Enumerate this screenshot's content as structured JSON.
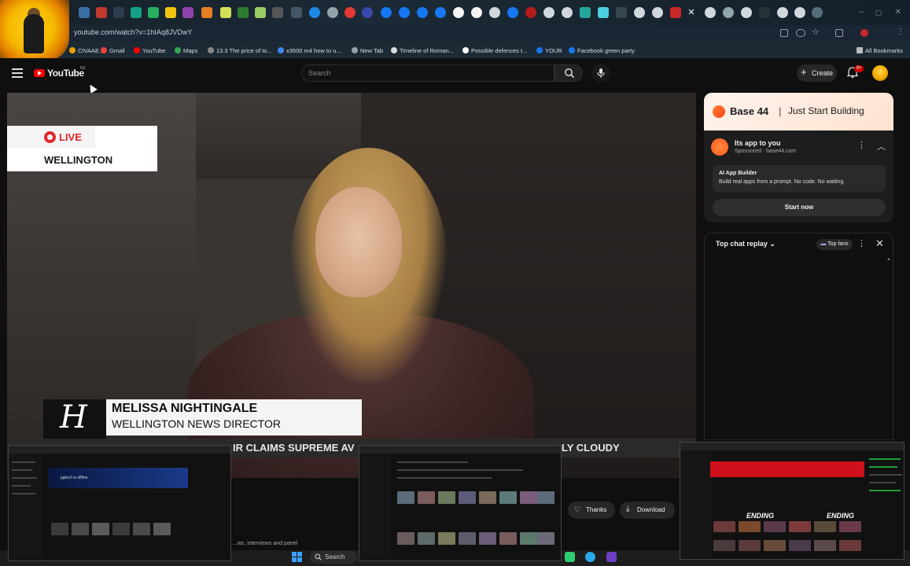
{
  "browser": {
    "url": "youtube.com/watch?v=1hIAq8JVDwY",
    "bookmarks": [
      {
        "label": "CIVAAE...",
        "color": "#e8a000"
      },
      {
        "label": "Gmail",
        "color": "#ea4335"
      },
      {
        "label": "YouTube",
        "color": "#ff0000"
      },
      {
        "label": "Maps",
        "color": "#34a853"
      },
      {
        "label": "13.3 The price of to...",
        "color": "#888888"
      },
      {
        "label": "x3500 m4 how to u...",
        "color": "#4285f4"
      },
      {
        "label": "New Tab",
        "color": "#9aa0a6"
      },
      {
        "label": "Timeline of Roman...",
        "color": "#dddddd"
      },
      {
        "label": "Possible defences t...",
        "color": "#ffffff"
      },
      {
        "label": "YOUR",
        "color": "#1877f2"
      },
      {
        "label": "Facebook green party",
        "color": "#1877f2"
      }
    ],
    "all_bookmarks": "All Bookmarks"
  },
  "header": {
    "logo_text": "YouTube",
    "region": "NZ",
    "search_placeholder": "Search",
    "create_label": "Create",
    "notification_count": "9+"
  },
  "video": {
    "live_label": "LIVE",
    "location": "WELLINGTON",
    "logo_letter": "H",
    "person_name": "MELISSA NIGHTINGALE",
    "person_title": "WELLINGTON NEWS DIRECTOR",
    "ticker_text": "IR CLAIMS SUPREME AV",
    "ticker_weather": "LY CLOUDY"
  },
  "ad": {
    "brand": "Base 44",
    "tagline": "Just Start Building",
    "headline": "Its app to you",
    "sponsored": "Sponsored · base44.com",
    "inner_title": "AI App Builder",
    "inner_desc": "Build real apps from a prompt. No code. No waiting.",
    "cta": "Start now"
  },
  "chat": {
    "title": "Top chat replay",
    "fans_label": "Top fans"
  },
  "actions": {
    "thanks": "Thanks",
    "download": "Download"
  },
  "description_snippet": "...ws, interviews and panel",
  "taskbar": {
    "search_label": "Search"
  },
  "thumbnails": {
    "left_title": "pglez2 is offline",
    "right_title_1": "ENDING",
    "right_title_2": "ENDING"
  }
}
